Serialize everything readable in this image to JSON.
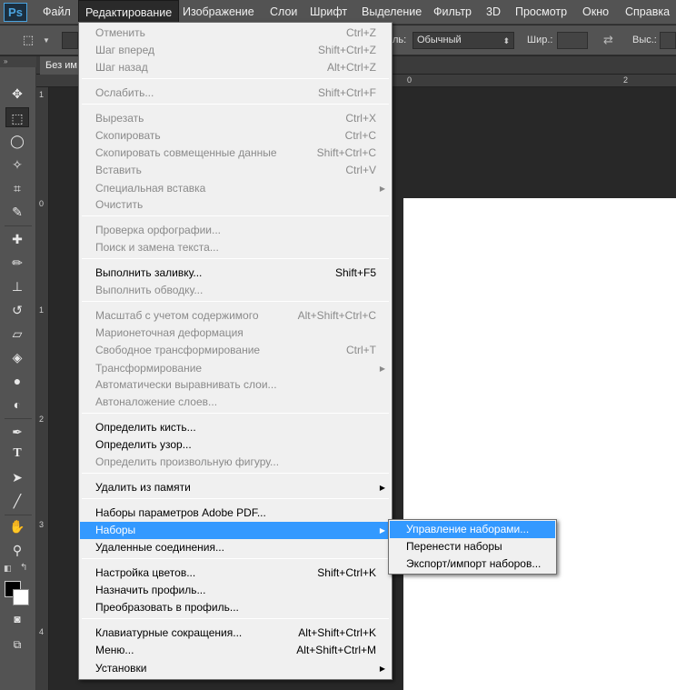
{
  "menubar": {
    "logo": "Ps",
    "items": [
      "Файл",
      "Редактирование",
      "Изображение",
      "Слои",
      "Шрифт",
      "Выделение",
      "Фильтр",
      "3D",
      "Просмотр",
      "Окно",
      "Справка"
    ],
    "active_index": 1
  },
  "options": {
    "mode_label": "ль:",
    "mode_value": "Обычный",
    "width_label": "Шир.:",
    "height_label": "Выс.:"
  },
  "document": {
    "tab_title": "Без им"
  },
  "toolbox": {
    "collapse_glyph": "»",
    "tools": [
      "move-tool",
      "rectangular-marquee-tool",
      "lasso-tool",
      "magic-wand-tool",
      "crop-tool",
      "eyedropper-tool",
      "spot-healing-tool",
      "brush-tool",
      "clone-stamp-tool",
      "history-brush-tool",
      "eraser-tool",
      "paint-bucket-tool",
      "blur-tool",
      "dodge-tool",
      "pen-tool",
      "type-tool",
      "path-selection-tool",
      "line-tool",
      "hand-tool",
      "zoom-tool"
    ]
  },
  "rulers": {
    "top": [
      "0",
      "2"
    ],
    "left": [
      "1",
      "0",
      "1",
      "2",
      "3",
      "4"
    ]
  },
  "edit_menu": {
    "items": [
      {
        "label": "Отменить",
        "shortcut": "Ctrl+Z",
        "disabled": true
      },
      {
        "label": "Шаг вперед",
        "shortcut": "Shift+Ctrl+Z",
        "disabled": true
      },
      {
        "label": "Шаг назад",
        "shortcut": "Alt+Ctrl+Z",
        "disabled": true
      },
      {
        "label": "Ослабить...",
        "shortcut": "Shift+Ctrl+F",
        "disabled": true
      },
      {
        "label": "Вырезать",
        "shortcut": "Ctrl+X",
        "disabled": true
      },
      {
        "label": "Скопировать",
        "shortcut": "Ctrl+C",
        "disabled": true
      },
      {
        "label": "Скопировать совмещенные данные",
        "shortcut": "Shift+Ctrl+C",
        "disabled": true
      },
      {
        "label": "Вставить",
        "shortcut": "Ctrl+V",
        "disabled": true
      },
      {
        "label": "Специальная вставка",
        "shortcut": "",
        "disabled": true,
        "submenu": true
      },
      {
        "label": "Очистить",
        "shortcut": "",
        "disabled": true
      },
      {
        "label": "Проверка орфографии...",
        "shortcut": "",
        "disabled": true
      },
      {
        "label": "Поиск и замена текста...",
        "shortcut": "",
        "disabled": true
      },
      {
        "label": "Выполнить заливку...",
        "shortcut": "Shift+F5",
        "disabled": false
      },
      {
        "label": "Выполнить обводку...",
        "shortcut": "",
        "disabled": true
      },
      {
        "label": "Масштаб с учетом содержимого",
        "shortcut": "Alt+Shift+Ctrl+C",
        "disabled": true
      },
      {
        "label": "Марионеточная деформация",
        "shortcut": "",
        "disabled": true
      },
      {
        "label": "Свободное трансформирование",
        "shortcut": "Ctrl+T",
        "disabled": true
      },
      {
        "label": "Трансформирование",
        "shortcut": "",
        "disabled": true,
        "submenu": true
      },
      {
        "label": "Автоматически выравнивать слои...",
        "shortcut": "",
        "disabled": true
      },
      {
        "label": "Автоналожение слоев...",
        "shortcut": "",
        "disabled": true
      },
      {
        "label": "Определить кисть...",
        "shortcut": "",
        "disabled": false
      },
      {
        "label": "Определить узор...",
        "shortcut": "",
        "disabled": false
      },
      {
        "label": "Определить произвольную фигуру...",
        "shortcut": "",
        "disabled": true
      },
      {
        "label": "Удалить из памяти",
        "shortcut": "",
        "disabled": false,
        "submenu": true
      },
      {
        "label": "Наборы параметров Adobe PDF...",
        "shortcut": "",
        "disabled": false
      },
      {
        "label": "Наборы",
        "shortcut": "",
        "disabled": false,
        "submenu": true,
        "highlighted": true
      },
      {
        "label": "Удаленные соединения...",
        "shortcut": "",
        "disabled": false
      },
      {
        "label": "Настройка цветов...",
        "shortcut": "Shift+Ctrl+K",
        "disabled": false
      },
      {
        "label": "Назначить профиль...",
        "shortcut": "",
        "disabled": false
      },
      {
        "label": "Преобразовать в профиль...",
        "shortcut": "",
        "disabled": false
      },
      {
        "label": "Клавиатурные сокращения...",
        "shortcut": "Alt+Shift+Ctrl+K",
        "disabled": false
      },
      {
        "label": "Меню...",
        "shortcut": "Alt+Shift+Ctrl+M",
        "disabled": false
      },
      {
        "label": "Установки",
        "shortcut": "",
        "disabled": false,
        "submenu": true
      }
    ]
  },
  "presets_submenu": {
    "items": [
      {
        "label": "Управление наборами...",
        "highlighted": true
      },
      {
        "label": "Перенести наборы",
        "highlighted": false
      },
      {
        "label": "Экспорт/импорт наборов...",
        "highlighted": false
      }
    ]
  },
  "colors": {
    "highlight": "#3399ff",
    "menu_bg": "#f0f0f0",
    "chrome": "#535353",
    "ps_blue": "#4aa3df"
  }
}
